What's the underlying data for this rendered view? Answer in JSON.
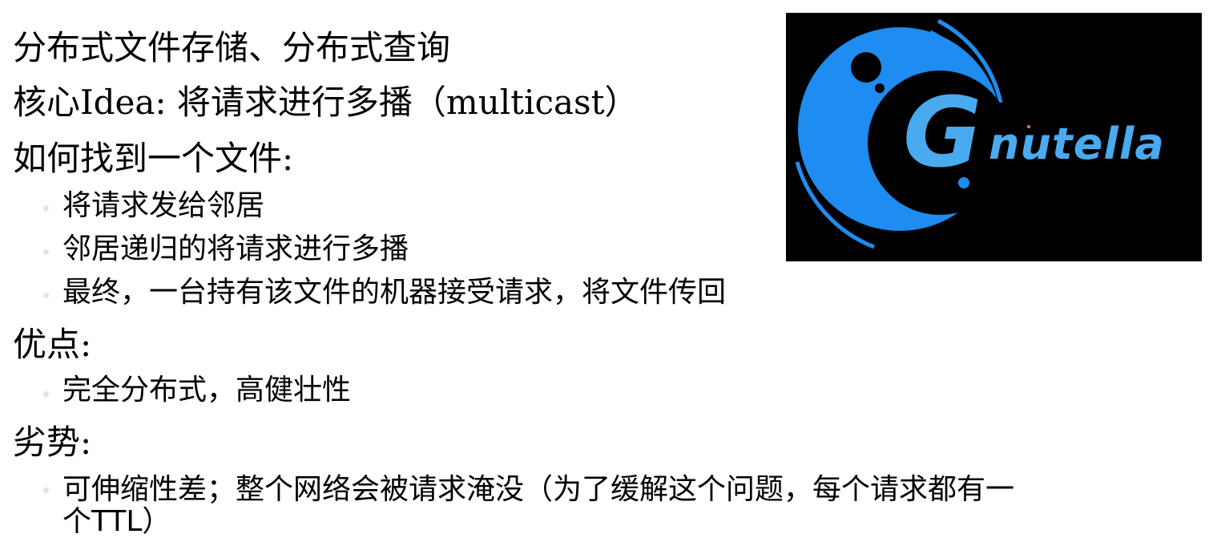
{
  "lines": {
    "l1": "分布式文件存储、分布式查询",
    "l2": "核心Idea: 将请求进行多播（multicast）",
    "l3": "如何找到一个文件:",
    "l3_b1": "将请求发给邻居",
    "l3_b2": "邻居递归的将请求进行多播",
    "l3_b3": "最终，一台持有该文件的机器接受请求，将文件传回",
    "l4": "优点:",
    "l4_b1": "完全分布式，高健壮性",
    "l5": "劣势:",
    "l5_b1_line1": "可伸缩性差；整个网络会被请求淹没（为了缓解这个问题，每个请求都有一",
    "l5_b1_line2": "个TTL）"
  },
  "logo": {
    "letter": "G",
    "word": "nutella",
    "colors": {
      "background": "#000000",
      "primary_blue": "#1e8cf0",
      "light_blue": "#4aaaf0"
    }
  }
}
